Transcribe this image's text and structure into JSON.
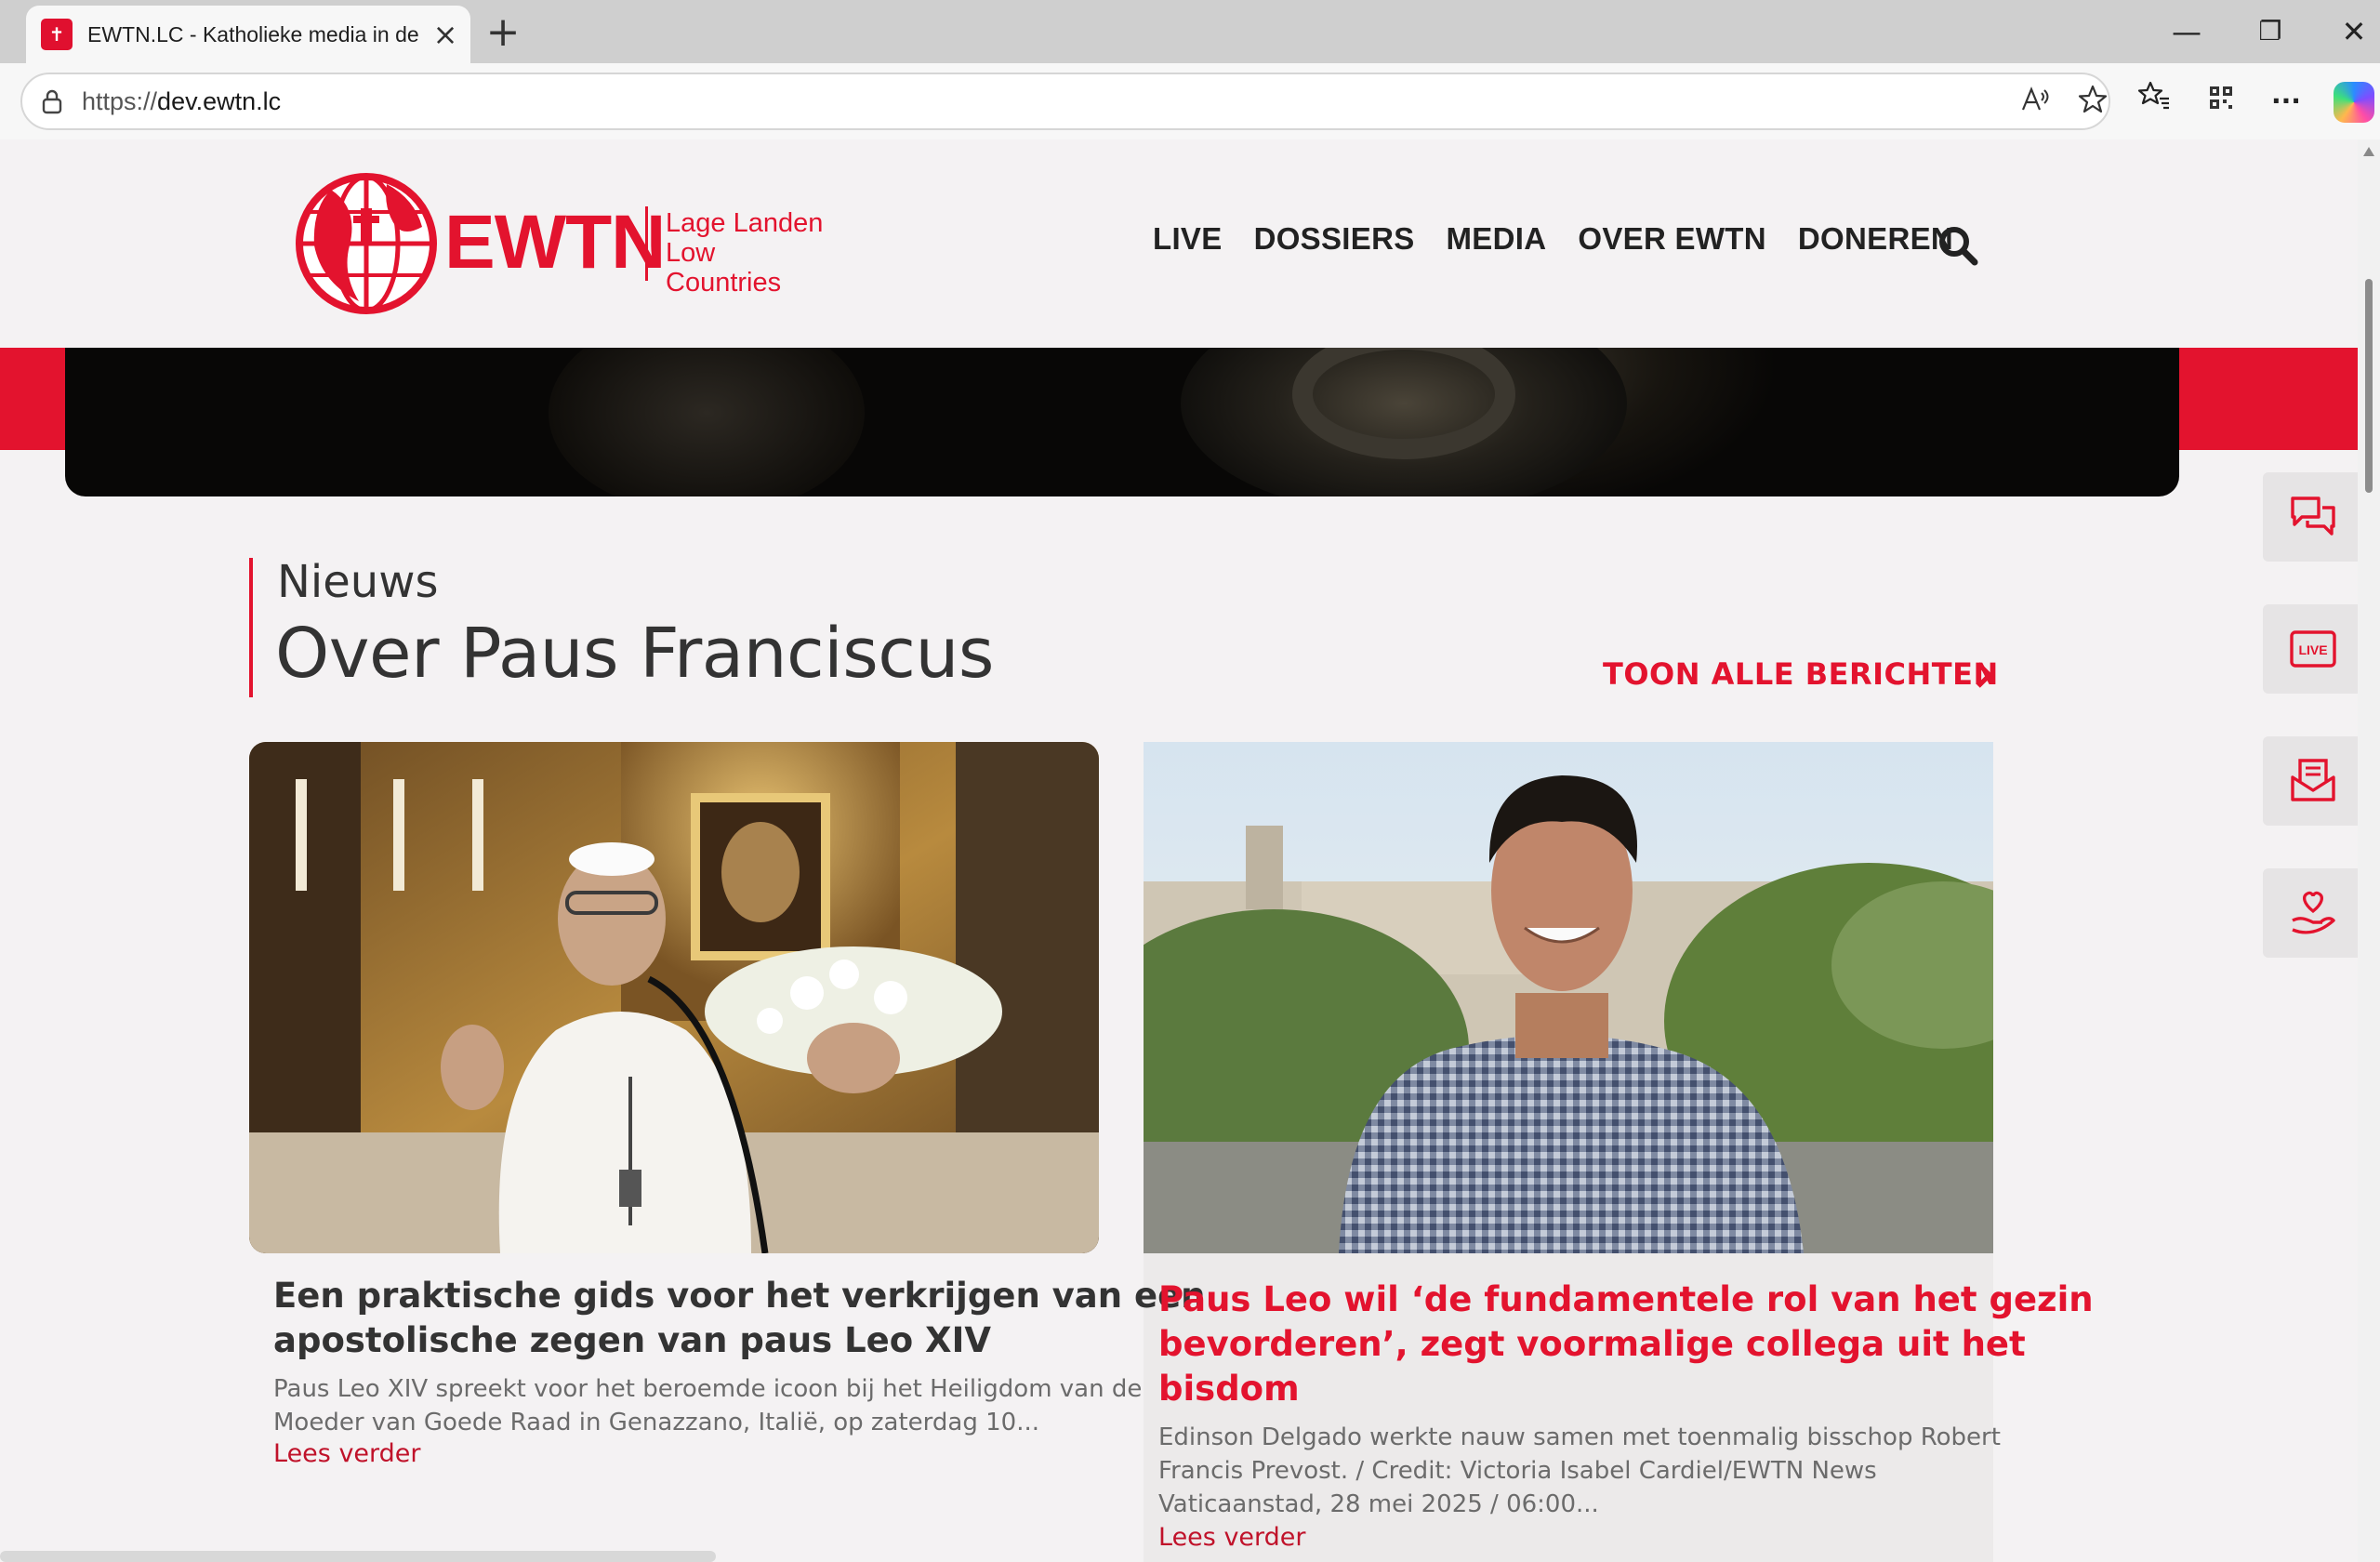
{
  "browser": {
    "tab_title": "EWTN.LC - Katholieke media in de",
    "tab_favicon_icon": "ewtn-favicon-icon",
    "url_scheme": "https://",
    "url_host": "dev.ewtn.lc",
    "new_tab_symbol": "+",
    "minimize_symbol": "—",
    "restore_symbol": "❐",
    "close_symbol": "✕",
    "tab_close_symbol": "×",
    "more_symbol": "···"
  },
  "site": {
    "logo_text": "EWTN",
    "logo_sub1": "Lage Landen",
    "logo_sub2": "Low Countries",
    "brand_color": "#e3132e",
    "nav": [
      "LIVE",
      "DOSSIERS",
      "MEDIA",
      "OVER EWTN",
      "DONEREN"
    ]
  },
  "section": {
    "kicker": "Nieuws",
    "title": "Over Paus Franciscus",
    "show_all": "TOON ALLE BERICHTEN"
  },
  "side_buttons": [
    "chat-icon",
    "live-icon",
    "newsletter-icon",
    "donate-heart-icon"
  ],
  "side_live_label": "LIVE",
  "articles": [
    {
      "title_line1": "Een praktische gids voor het verkrijgen van een",
      "title_line2": "apostolische zegen van paus Leo XIV",
      "excerpt_line1": "Paus Leo XIV spreekt voor het beroemde icoon bij het Heiligdom van de",
      "excerpt_line2": "Moeder van Goede Raad in Genazzano, Italië, op zaterdag 10...",
      "read_more": "Lees verder"
    },
    {
      "title_line1": "Paus Leo wil ‘de fundamentele rol van het gezin",
      "title_line2": "bevorderen’, zegt voormalige collega uit het",
      "title_line3": "bisdom",
      "excerpt_line1": "Edinson Delgado werkte nauw samen met toenmalig bisschop Robert",
      "excerpt_line2": "Francis Prevost. / Credit: Victoria Isabel Cardiel/EWTN News",
      "excerpt_line3": "Vaticaanstad, 28 mei 2025 / 06:00...",
      "read_more": "Lees verder"
    }
  ]
}
